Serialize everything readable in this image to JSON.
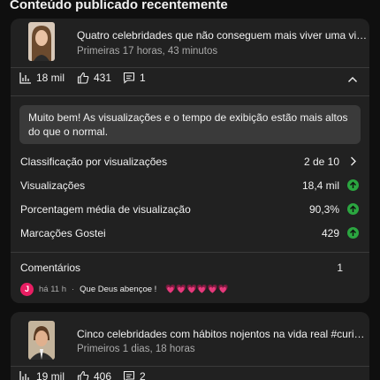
{
  "section": {
    "title": "Conteúdo publicado recentemente"
  },
  "video1": {
    "title": "Quatro celebridades que não conseguem mais viver uma vida...",
    "date": "Primeiras 17 horas, 43 minutos",
    "stats": {
      "views": "18 mil",
      "likes": "431",
      "comments": "1"
    },
    "highlight": "Muito bem! As visualizações e o tempo de exibição estão mais altos do que o normal.",
    "metrics": [
      {
        "label": "Classificação por visualizações",
        "value": "2 de 10",
        "end_icon": "chevron-right-icon"
      },
      {
        "label": "Visualizações",
        "value": "18,4 mil",
        "end_icon": "arrow-up-icon"
      },
      {
        "label": "Porcentagem média de visualização",
        "value": "90,3%",
        "end_icon": "arrow-up-icon"
      },
      {
        "label": "Marcações Gostei",
        "value": "429",
        "end_icon": "arrow-up-icon"
      }
    ],
    "comments": {
      "label": "Comentários",
      "count": "1"
    },
    "latest_comment": {
      "avatar_letter": "J",
      "time": "há 11 h",
      "separator": "·",
      "text": "Que Deus abençoe !",
      "emoji": "💗💗💗💗💗💗"
    }
  },
  "video2": {
    "title": "Cinco celebridades com hábitos nojentos na vida real #curio...",
    "date": "Primeiros 1 dias, 18 horas",
    "stats": {
      "views": "19 mil",
      "likes": "406",
      "comments": "2"
    }
  },
  "colors": {
    "card": "#212121",
    "highlight": "#3a3a3a",
    "up": "#2ba640",
    "avatar": "#e91e63"
  }
}
